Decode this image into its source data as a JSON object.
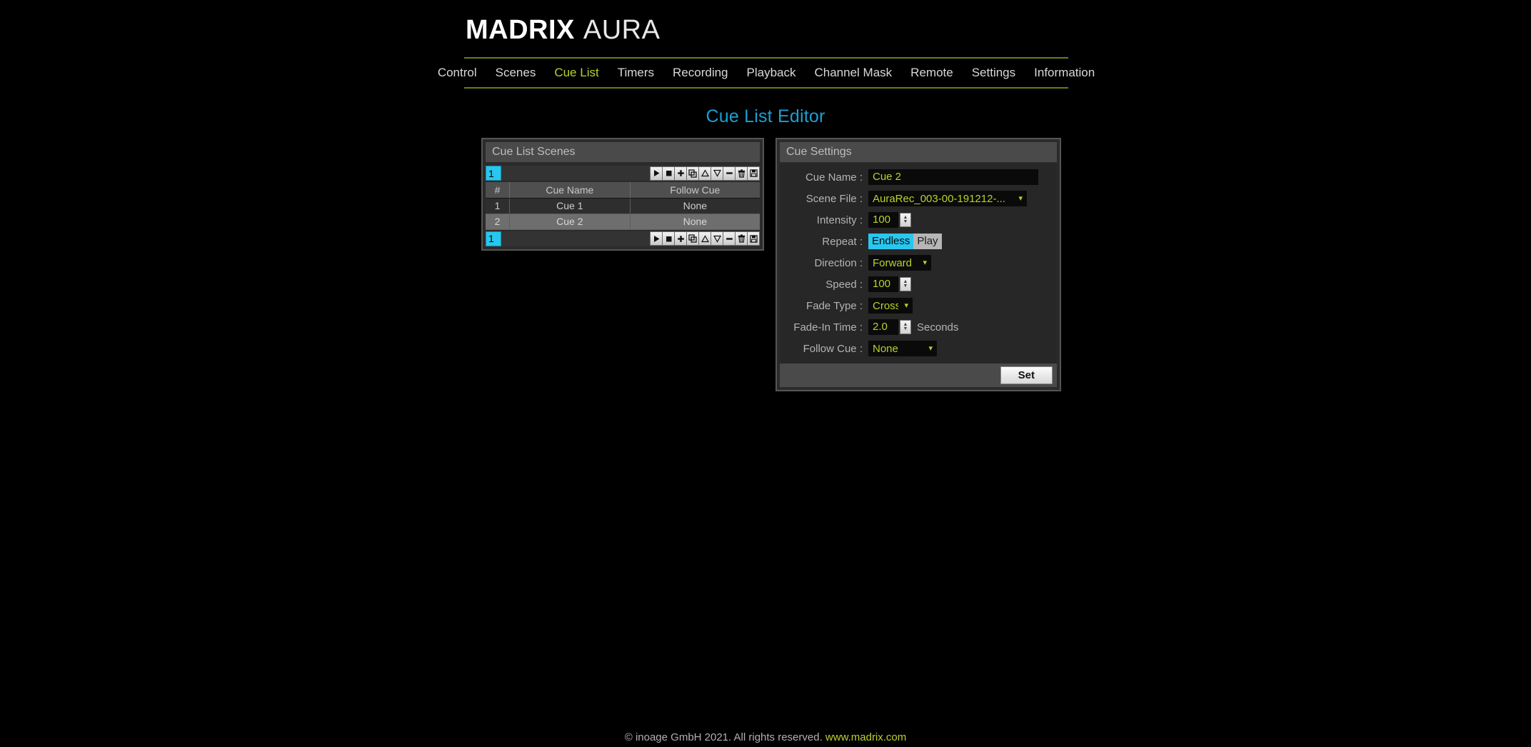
{
  "brand": {
    "name_bold": "MADRIX",
    "name_light": "AURA"
  },
  "nav": {
    "items": [
      {
        "label": "Control",
        "active": false
      },
      {
        "label": "Scenes",
        "active": false
      },
      {
        "label": "Cue List",
        "active": true
      },
      {
        "label": "Timers",
        "active": false
      },
      {
        "label": "Recording",
        "active": false
      },
      {
        "label": "Playback",
        "active": false
      },
      {
        "label": "Channel Mask",
        "active": false
      },
      {
        "label": "Remote",
        "active": false
      },
      {
        "label": "Settings",
        "active": false
      },
      {
        "label": "Information",
        "active": false
      }
    ]
  },
  "page": {
    "title": "Cue List Editor"
  },
  "scenes_panel": {
    "title": "Cue List Scenes",
    "index_badge": "1",
    "toolbar_icons": [
      "play-icon",
      "stop-icon",
      "add-icon",
      "duplicate-icon",
      "move-up-icon",
      "move-down-icon",
      "remove-icon",
      "delete-icon",
      "save-icon"
    ],
    "columns": [
      "#",
      "Cue Name",
      "Follow Cue"
    ],
    "rows": [
      {
        "num": "1",
        "name": "Cue 1",
        "follow": "None",
        "selected": false
      },
      {
        "num": "2",
        "name": "Cue 2",
        "follow": "None",
        "selected": true
      }
    ]
  },
  "settings_panel": {
    "title": "Cue Settings",
    "cue_name": {
      "label": "Cue Name :",
      "value": "Cue 2"
    },
    "scene_file": {
      "label": "Scene File :",
      "value": "AuraRec_003-00-191212-..."
    },
    "intensity": {
      "label": "Intensity :",
      "value": "100"
    },
    "repeat": {
      "label": "Repeat :",
      "options": [
        {
          "label": "Endless",
          "selected": true
        },
        {
          "label": "Play",
          "selected": false
        }
      ]
    },
    "direction": {
      "label": "Direction :",
      "value": "Forward"
    },
    "speed": {
      "label": "Speed :",
      "value": "100"
    },
    "fade_type": {
      "label": "Fade Type :",
      "value": "Cross"
    },
    "fade_in_time": {
      "label": "Fade-In Time :",
      "value": "2.0",
      "unit": "Seconds"
    },
    "follow_cue": {
      "label": "Follow Cue :",
      "value": "None"
    },
    "set_button": "Set"
  },
  "footer": {
    "copyright": "© inoage GmbH 2021. All rights reserved.",
    "link": "www.madrix.com"
  },
  "colors": {
    "accent_green": "#b9d22c",
    "accent_cyan": "#29c6ee",
    "title_blue": "#1c9fd4",
    "rule_olive": "#6f7a14"
  }
}
